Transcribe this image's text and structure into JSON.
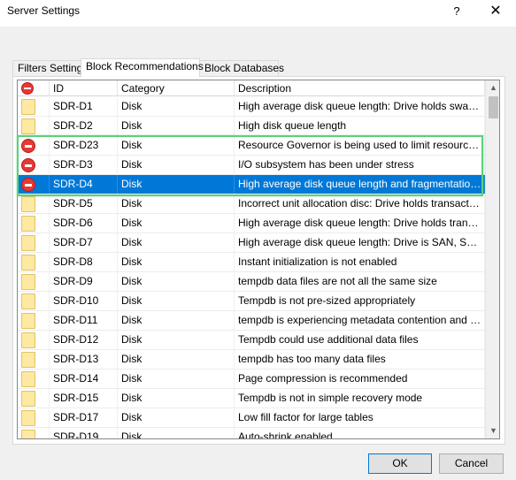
{
  "window": {
    "title": "Server Settings",
    "help_label": "?",
    "close_label": "✕"
  },
  "tabs": [
    {
      "label": "Filters Settings",
      "active": false
    },
    {
      "label": "Block Recommendations",
      "active": true
    },
    {
      "label": "Block Databases",
      "active": false
    }
  ],
  "grid": {
    "columns": {
      "icon": "block-icon",
      "id": "ID",
      "category": "Category",
      "description": "Description"
    },
    "rows": [
      {
        "icon": "folder-icon",
        "id": "SDR-D1",
        "category": "Disk",
        "description": "High average disk queue length: Drive holds swap files",
        "selected": false
      },
      {
        "icon": "folder-icon",
        "id": "SDR-D2",
        "category": "Disk",
        "description": "High disk queue length",
        "selected": false
      },
      {
        "icon": "block-icon",
        "id": "SDR-D23",
        "category": "Disk",
        "description": "Resource Governor is being used to limit resources of...",
        "selected": false
      },
      {
        "icon": "block-icon",
        "id": "SDR-D3",
        "category": "Disk",
        "description": "I/O subsystem has been under stress",
        "selected": false
      },
      {
        "icon": "block-icon",
        "id": "SDR-D4",
        "category": "Disk",
        "description": "High average disk queue length and fragmentation: D...",
        "selected": true
      },
      {
        "icon": "folder-icon",
        "id": "SDR-D5",
        "category": "Disk",
        "description": "Incorrect unit allocation disc: Drive holds transaction l...",
        "selected": false
      },
      {
        "icon": "folder-icon",
        "id": "SDR-D6",
        "category": "Disk",
        "description": "High average disk queue length: Drive holds transacti...",
        "selected": false
      },
      {
        "icon": "folder-icon",
        "id": "SDR-D7",
        "category": "Disk",
        "description": "High average disk queue length: Drive is SAN, SSD,...",
        "selected": false
      },
      {
        "icon": "folder-icon",
        "id": "SDR-D8",
        "category": "Disk",
        "description": "Instant initialization is not enabled",
        "selected": false
      },
      {
        "icon": "folder-icon",
        "id": "SDR-D9",
        "category": "Disk",
        "description": "tempdb data files are not all the same size",
        "selected": false
      },
      {
        "icon": "folder-icon",
        "id": "SDR-D10",
        "category": "Disk",
        "description": "Tempdb is not pre-sized appropriately",
        "selected": false
      },
      {
        "icon": "folder-icon",
        "id": "SDR-D11",
        "category": "Disk",
        "description": "tempdb is experiencing metadata contention and waits",
        "selected": false
      },
      {
        "icon": "folder-icon",
        "id": "SDR-D12",
        "category": "Disk",
        "description": "Tempdb could use additional data files",
        "selected": false
      },
      {
        "icon": "folder-icon",
        "id": "SDR-D13",
        "category": "Disk",
        "description": "tempdb has too many data files",
        "selected": false
      },
      {
        "icon": "folder-icon",
        "id": "SDR-D14",
        "category": "Disk",
        "description": "Page compression is recommended",
        "selected": false
      },
      {
        "icon": "folder-icon",
        "id": "SDR-D15",
        "category": "Disk",
        "description": "Tempdb is not in simple recovery mode",
        "selected": false
      },
      {
        "icon": "folder-icon",
        "id": "SDR-D17",
        "category": "Disk",
        "description": "Low fill factor for large tables",
        "selected": false
      },
      {
        "icon": "folder-icon",
        "id": "SDR-D19",
        "category": "Disk",
        "description": "Auto-shrink enabled",
        "selected": false
      }
    ]
  },
  "scrollbar": {
    "up_icon": "chevron-up-icon",
    "down_icon": "chevron-down-icon"
  },
  "buttons": {
    "ok_label": "OK",
    "cancel_label": "Cancel"
  },
  "colors": {
    "selection": "#0078d7",
    "highlight_box": "#5bd17a",
    "block_icon": "#e53935",
    "folder_icon": "#fde9a2"
  }
}
